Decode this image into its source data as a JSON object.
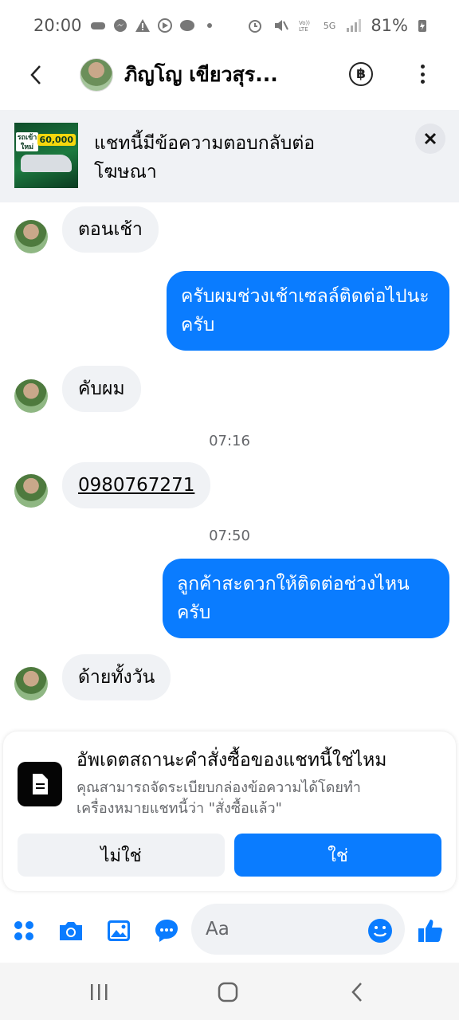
{
  "status_bar": {
    "time": "20:00",
    "battery": "81%",
    "network_label": "5G"
  },
  "header": {
    "contact_name": "ภิญโญ เขียวสุร...",
    "currency_symbol": "฿"
  },
  "ad_banner": {
    "text": "แชทนี้มีข้อความตอบกลับต่อโฆษณา",
    "thumb_headline": "รถเข้าใหม่",
    "thumb_price": "60,000"
  },
  "messages": [
    {
      "direction": "in",
      "text": "ตอนเช้า"
    },
    {
      "direction": "out",
      "text": "ครับผมช่วงเช้าเซลล์ติดต่อไปนะครับ"
    },
    {
      "direction": "in",
      "text": "คับผม"
    },
    {
      "type": "timestamp",
      "text": "07:16"
    },
    {
      "direction": "in",
      "text": "0980767271",
      "is_phone": true
    },
    {
      "type": "timestamp",
      "text": "07:50"
    },
    {
      "direction": "out",
      "text": "ลูกค้าสะดวกให้ติดต่อช่วงไหนครับ"
    },
    {
      "direction": "in",
      "text": "ด้ายทั้งวัน"
    }
  ],
  "order_card": {
    "title": "อัพเดตสถานะคำสั่งซื้อของแชทนี้ใช่ไหม",
    "description": "คุณสามารถจัดระเบียบกล่องข้อความได้โดยทำเครื่องหมายแชทนี้ว่า \"สั่งซื้อแล้ว\"",
    "no_label": "ไม่ใช่",
    "yes_label": "ใช่"
  },
  "composer": {
    "placeholder": "Aa"
  },
  "colors": {
    "accent": "#0a7cff",
    "bubble_in": "#f0f2f5",
    "secondary_text": "#65676b"
  }
}
